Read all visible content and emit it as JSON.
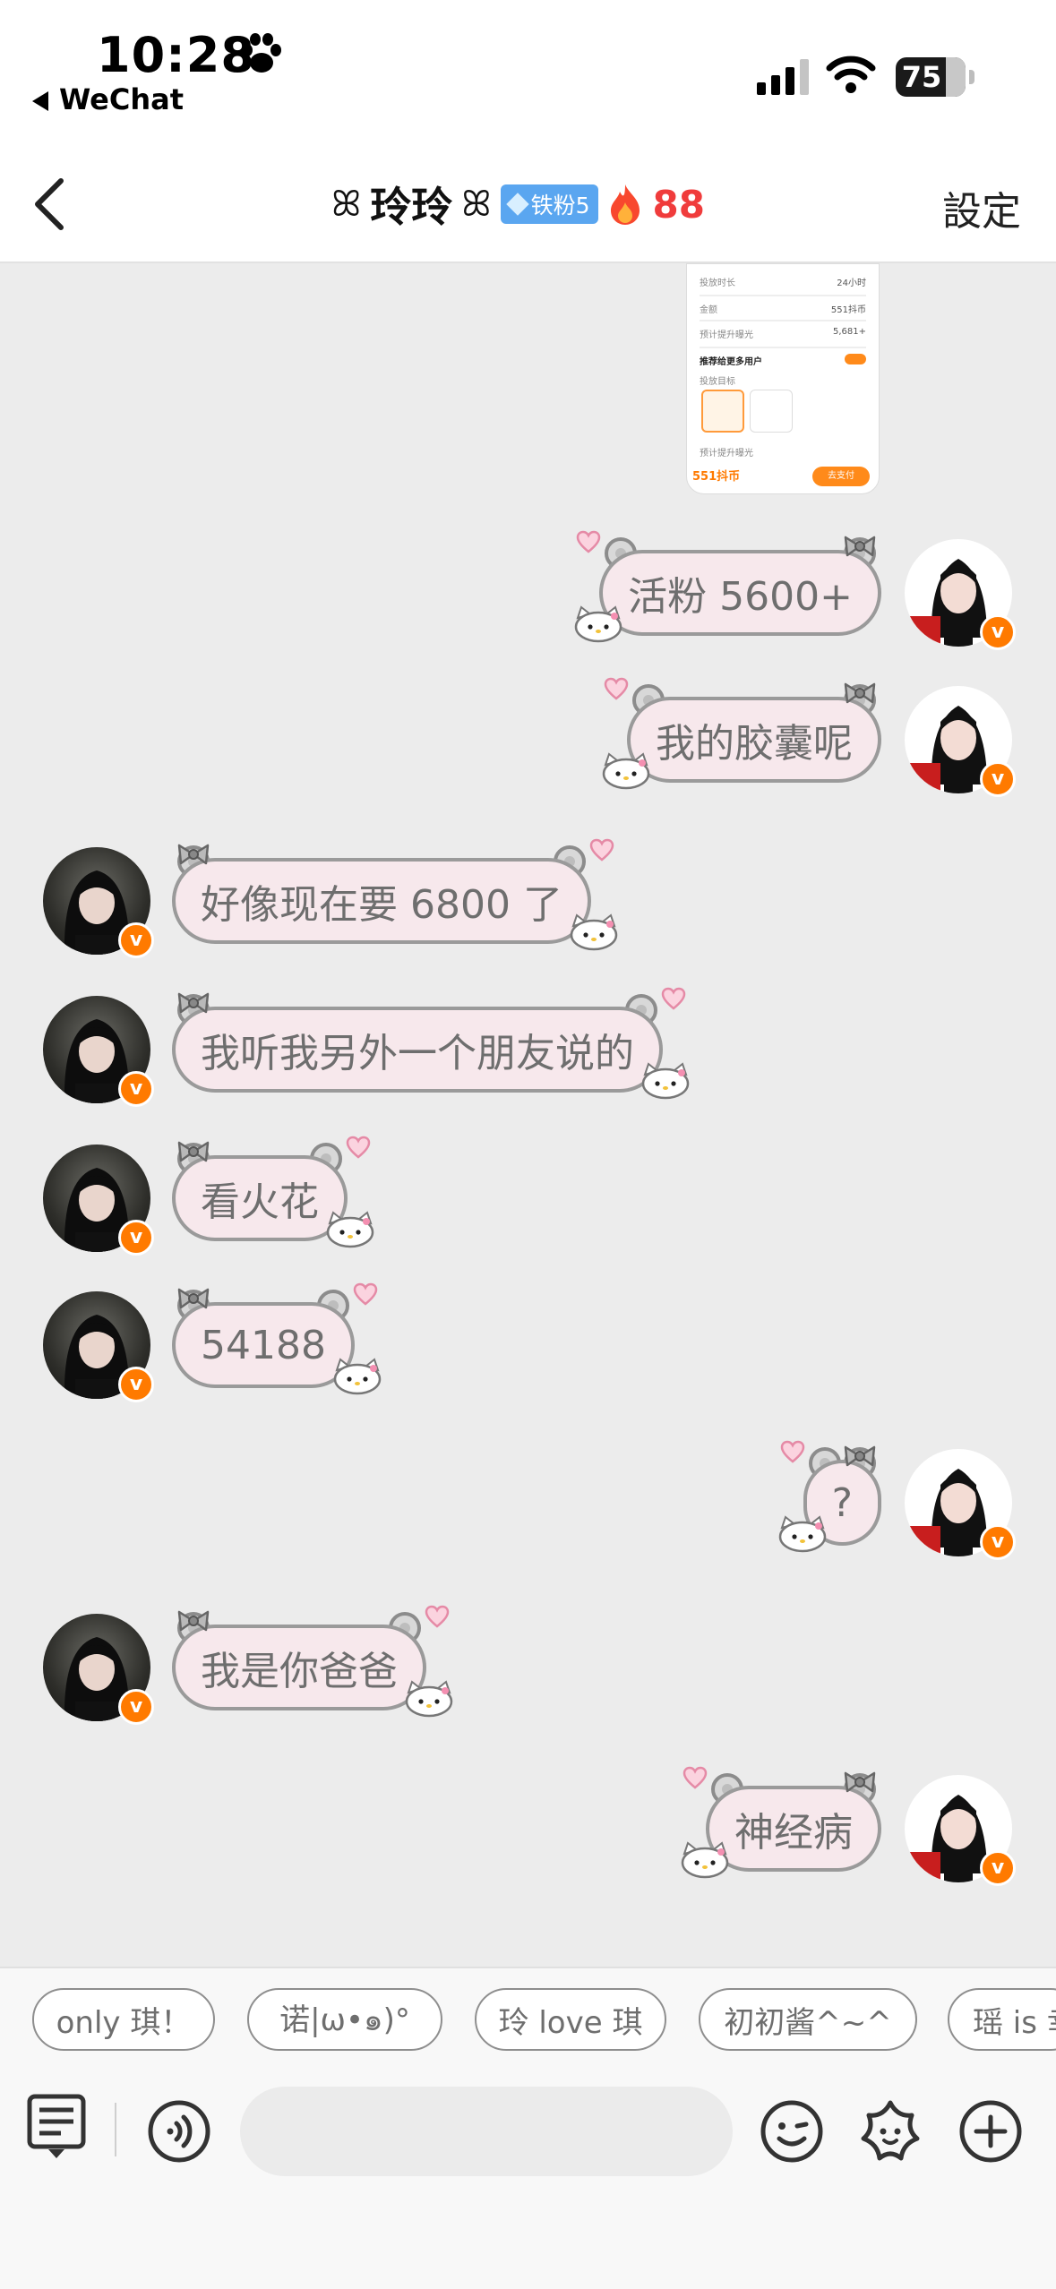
{
  "status_bar": {
    "time": "10:28",
    "back_app": "WeChat",
    "battery": "75"
  },
  "header": {
    "title": "玲玲",
    "title_deco_left": "ꕤ",
    "title_deco_right": "ꕤ",
    "fan_badge": "铁粉5",
    "spark_count": "88",
    "settings": "設定"
  },
  "shared_image": {
    "rows": [
      "投放时长",
      "金额",
      "预计提升曝光",
      "推荐给更多用户",
      "投放目标",
      "预计提升曝光"
    ],
    "values": [
      "24小时",
      "551抖币",
      "5,681+"
    ],
    "price": "551抖币",
    "buy_button": "去支付"
  },
  "messages": [
    {
      "side": "me",
      "text": "活粉 5600+"
    },
    {
      "side": "me",
      "text": "我的胶囊呢"
    },
    {
      "side": "them",
      "text": "好像现在要 6800 了"
    },
    {
      "side": "them",
      "text": "我听我另外一个朋友说的"
    },
    {
      "side": "them",
      "text": "看火花"
    },
    {
      "side": "them",
      "text": "54188"
    },
    {
      "side": "me",
      "text": "?"
    },
    {
      "side": "them",
      "text": "我是你爸爸"
    },
    {
      "side": "me",
      "text": "神经病"
    }
  ],
  "quick_replies": [
    "only 琪！",
    "诺|ω•๑)°",
    "玲 love 琪",
    "初初酱^~^",
    "瑶 is 幸"
  ],
  "input": {
    "placeholder": ""
  },
  "colors": {
    "bubble_fill": "#f7e8ec",
    "bubble_border": "#9a9a9a",
    "badge_orange": "#ff7a00",
    "spark_red": "#f03c3c",
    "fan_badge_blue": "#5aa6f0"
  },
  "icons": [
    "paw-icon",
    "signal-icon",
    "wifi-icon",
    "battery-icon",
    "back-arrow-icon",
    "flame-icon",
    "menu-list-icon",
    "voice-icon",
    "emoji-icon",
    "sticker-icon",
    "plus-icon"
  ]
}
